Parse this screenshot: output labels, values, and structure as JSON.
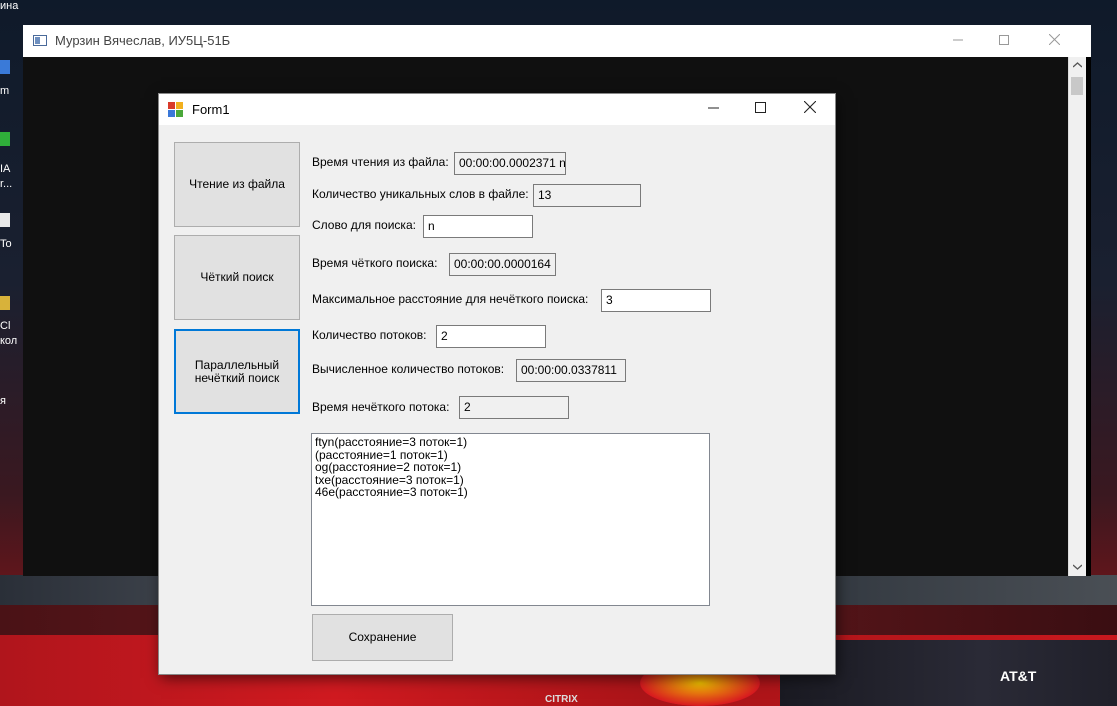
{
  "outer_window": {
    "title": "Мурзин Вячеслав, ИУ5Ц-51Б"
  },
  "desktop_fragments": [
    "ина",
    "m",
    "IA",
    "r...",
    "To",
    "Cl",
    "кол",
    "я"
  ],
  "wallpaper_text": {
    "brand": "AT&T",
    "sponsor": "CITRIX"
  },
  "form": {
    "title": "Form1",
    "buttons": {
      "read_file": "Чтение из файла",
      "exact_search": "Чёткий поиск",
      "parallel_fuzzy_search": "Параллельный нечёткий поиск",
      "save": "Сохранение"
    },
    "fields": {
      "read_time": {
        "label": "Время чтения из файла:",
        "value": "00:00:00.0002371 n"
      },
      "unique_words": {
        "label": "Количество уникальных слов в файле:",
        "value": "13"
      },
      "search_word": {
        "label": "Слово для поиска:",
        "value": "n"
      },
      "exact_search_time": {
        "label": "Время чёткого поиска:",
        "value": "00:00:00.0000164"
      },
      "max_distance": {
        "label": "Максимальное расстояние для нечёткого поиска:",
        "value": "3"
      },
      "thread_count": {
        "label": "Количество потоков:",
        "value": "2"
      },
      "computed_threads": {
        "label": "Вычисленное количество потоков:",
        "value": "00:00:00.0337811"
      },
      "fuzzy_thread_time": {
        "label": "Время нечёткого потока:",
        "value": "2"
      }
    },
    "results": [
      "ftyn(расстояние=3 поток=1)",
      " (расстояние=1 поток=1)",
      "og(расстояние=2 поток=1)",
      "txe(расстояние=3 поток=1)",
      "46e(расстояние=3 поток=1)"
    ]
  },
  "icons": {
    "outer_app": "window-app-icon",
    "form_app": "winforms-app-icon",
    "minimize": "minimize-icon",
    "maximize": "maximize-icon",
    "close": "close-icon"
  }
}
